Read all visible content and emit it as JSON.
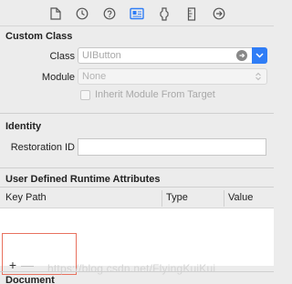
{
  "toolbar": {
    "icons": [
      "file-icon",
      "history-icon",
      "help-icon",
      "identity-inspector-icon",
      "attributes-icon",
      "size-icon",
      "connections-icon"
    ]
  },
  "custom_class": {
    "title": "Custom Class",
    "class_label": "Class",
    "class_placeholder": "UIButton",
    "module_label": "Module",
    "module_placeholder": "None",
    "inherit_label": "Inherit Module From Target"
  },
  "identity": {
    "title": "Identity",
    "restoration_label": "Restoration ID",
    "restoration_value": ""
  },
  "runtime_attributes": {
    "title": "User Defined Runtime Attributes",
    "columns": [
      "Key Path",
      "Type",
      "Value"
    ],
    "add_label": "+",
    "remove_label": "—"
  },
  "watermark": "https://blog.csdn.net/FlyingKuiKui",
  "document": {
    "title": "Document"
  },
  "colors": {
    "accent": "#2f7df6",
    "highlight_border": "#e8715e"
  }
}
